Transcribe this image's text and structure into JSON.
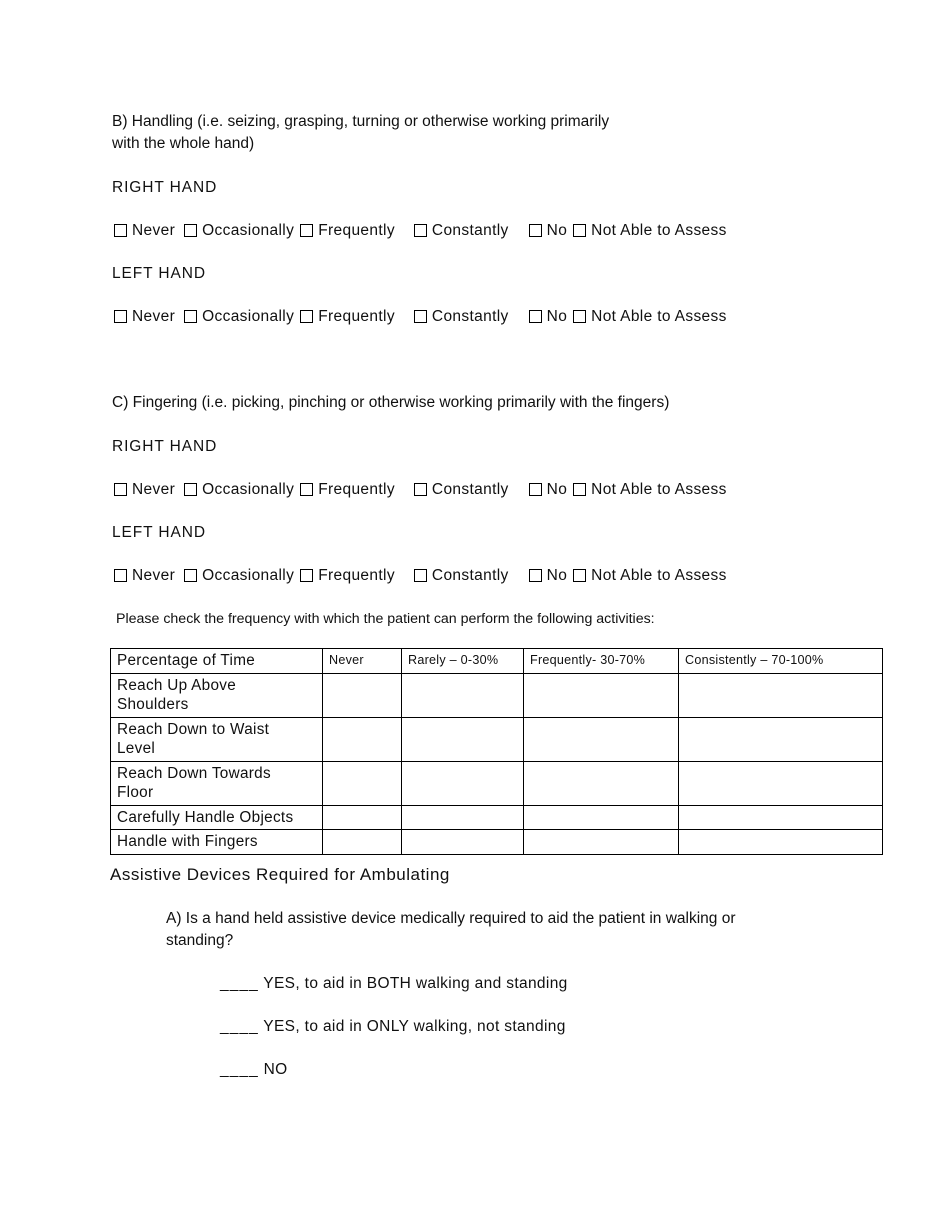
{
  "document": {
    "sections": [
      {
        "id": "handling",
        "heading": "B) Handling (i.e. seizing, grasping, turning or otherwise working primarily\nwith the whole hand)",
        "right_hand_label": "RIGHT HAND",
        "left_hand_label": "LEFT HAND"
      },
      {
        "id": "fingering",
        "heading": "C) Fingering (i.e. picking, pinching or otherwise working primarily with the fingers)",
        "right_hand_label": "RIGHT HAND",
        "left_hand_label": "LEFT HAND"
      }
    ],
    "frequency_options": {
      "never": "Never",
      "occasionally": "Occasionally",
      "frequently": "Frequently",
      "constantly": "Constantly",
      "no": "No",
      "not_able_to_assess": "Not Able to Assess"
    },
    "table_intro": "Please check the frequency with which the patient can perform the following activities:",
    "activity_table": {
      "headers": [
        "Percentage of Time",
        "Never",
        "Rarely – 0-30%",
        "Frequently- 30-70%",
        "Consistently – 70-100%"
      ],
      "rows": [
        {
          "label": "Reach Up Above\nShoulders",
          "values": [
            "",
            "",
            "",
            ""
          ]
        },
        {
          "label": "Reach Down to Waist\nLevel",
          "values": [
            "",
            "",
            "",
            ""
          ]
        },
        {
          "label": "Reach Down Towards\nFloor",
          "values": [
            "",
            "",
            "",
            ""
          ]
        },
        {
          "label": "Carefully Handle Objects",
          "values": [
            "",
            "",
            "",
            ""
          ]
        },
        {
          "label": "Handle with Fingers",
          "values": [
            "",
            "",
            "",
            ""
          ]
        }
      ]
    },
    "assistive": {
      "heading": "Assistive Devices Required for Ambulating",
      "question_a": "A) Is a hand held assistive device medically required to aid the patient in walking or\nstanding?",
      "blank": "____",
      "options": [
        "YES, to aid in BOTH walking and standing",
        "YES, to aid in ONLY  walking, not standing",
        "NO"
      ]
    }
  }
}
